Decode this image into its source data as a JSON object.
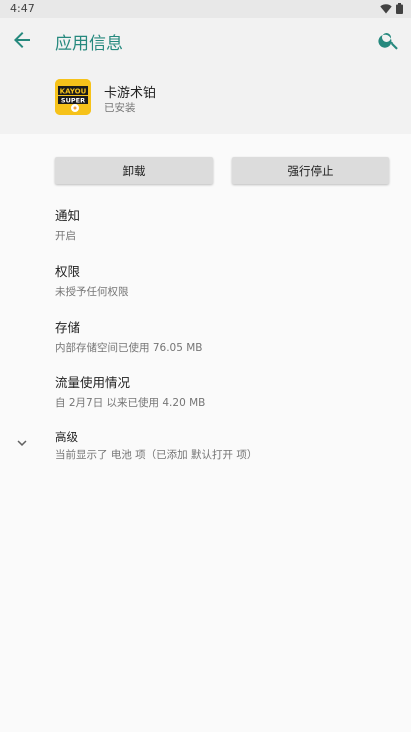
{
  "status_bar": {
    "time": "4:47"
  },
  "app_bar": {
    "title": "应用信息"
  },
  "app": {
    "name": "卡游术铂",
    "status": "已安装",
    "icon_text_top": "KAYOU",
    "icon_text_bottom": "SUPER"
  },
  "actions": {
    "uninstall": "卸载",
    "force_stop": "强行停止"
  },
  "items": [
    {
      "title": "通知",
      "subtitle": "开启"
    },
    {
      "title": "权限",
      "subtitle": "未授予任何权限"
    },
    {
      "title": "存储",
      "subtitle": "内部存储空间已使用 76.05 MB"
    },
    {
      "title": "流量使用情况",
      "subtitle": "自 2月7日 以来已使用 4.20 MB"
    },
    {
      "title": "高级",
      "subtitle": "当前显示了 电池 项（已添加 默认打开 项）"
    }
  ],
  "colors": {
    "accent": "#26897e",
    "header_bg": "#f2f2f2",
    "button_bg": "#dcdcdc"
  }
}
